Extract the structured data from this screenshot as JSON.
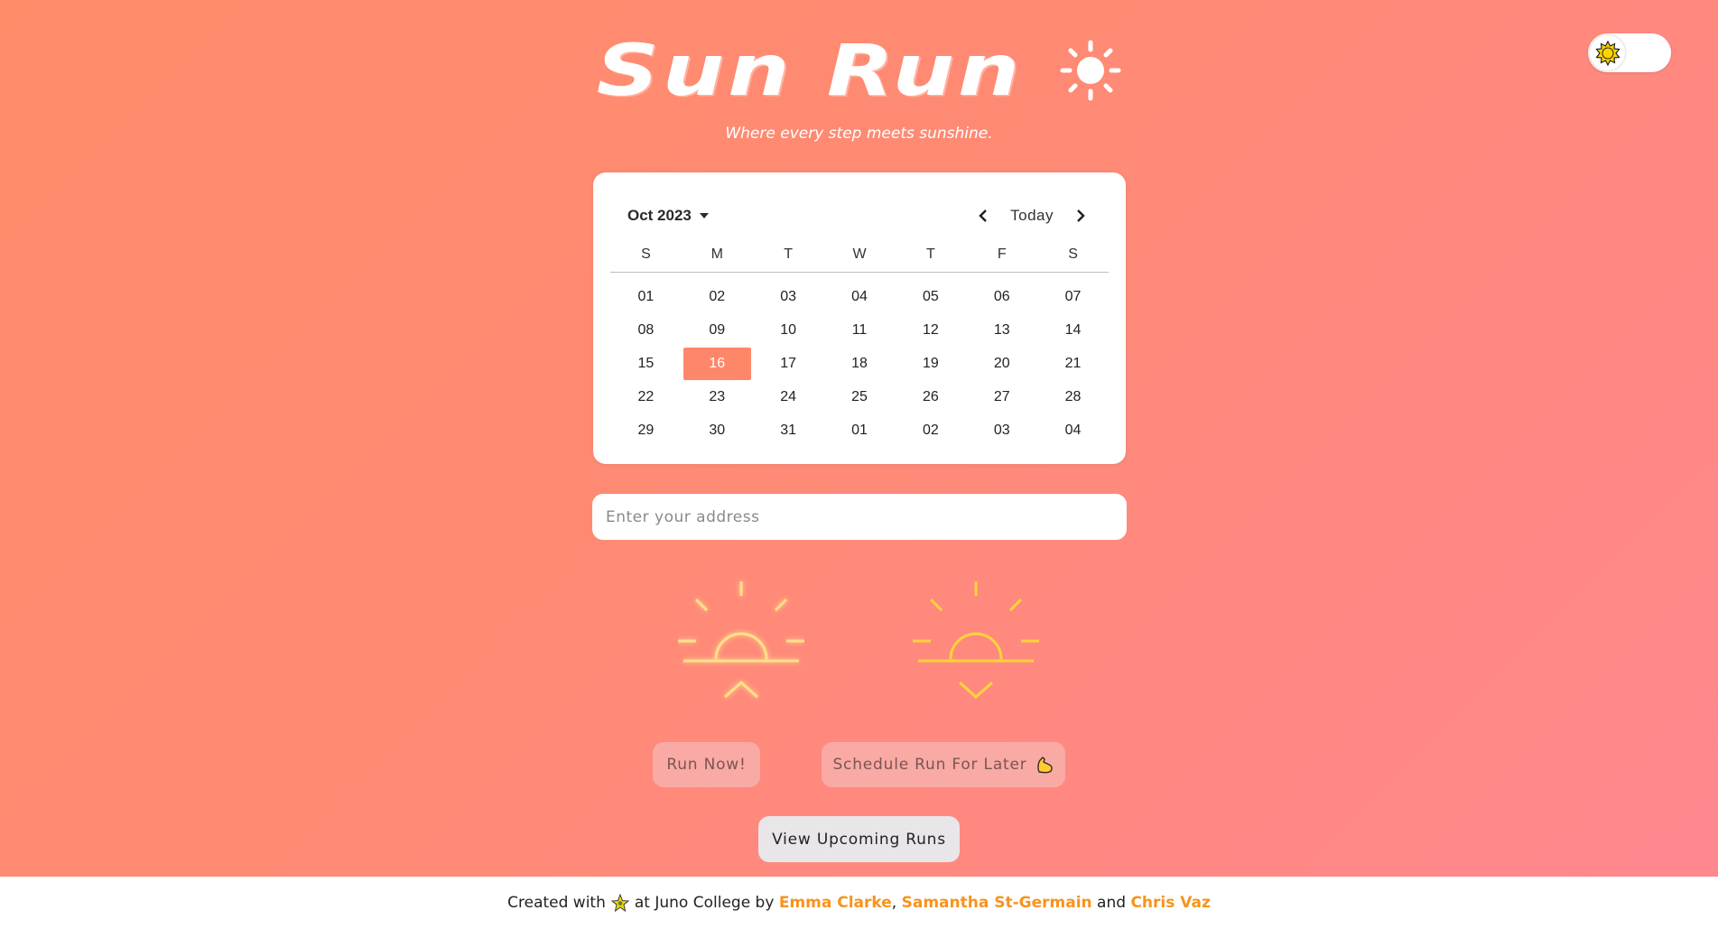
{
  "header": {
    "title": "Sun Run",
    "tagline": "Where every step meets sunshine."
  },
  "theme_toggle": {
    "icon": "sun-icon",
    "state": "light"
  },
  "calendar": {
    "month_label": "Oct 2023",
    "today_label": "Today",
    "weekdays": [
      "S",
      "M",
      "T",
      "W",
      "T",
      "F",
      "S"
    ],
    "days": [
      "01",
      "02",
      "03",
      "04",
      "05",
      "06",
      "07",
      "08",
      "09",
      "10",
      "11",
      "12",
      "13",
      "14",
      "15",
      "16",
      "17",
      "18",
      "19",
      "20",
      "21",
      "22",
      "23",
      "24",
      "25",
      "26",
      "27",
      "28",
      "29",
      "30",
      "31",
      "01",
      "02",
      "03",
      "04"
    ],
    "selected_day": "16"
  },
  "address": {
    "placeholder": "Enter your address",
    "value": ""
  },
  "options": {
    "sunrise_icon": "sunrise-icon",
    "sunset_icon": "sunset-icon"
  },
  "buttons": {
    "run_now": "Run Now!",
    "schedule": "Schedule Run For Later",
    "schedule_emoji": "flexed-arm-icon",
    "upcoming": "View Upcoming Runs"
  },
  "footer": {
    "created_with": "Created with",
    "heart_icon": "sparkle-star-icon",
    "at": "at Juno College by",
    "author1": "Emma Clarke",
    "comma": ",",
    "author2": "Samantha St-Germain",
    "and": "and",
    "author3": "Chris Vaz"
  },
  "colors": {
    "accent": "#ff8769",
    "sun_yellow": "#ffd54a",
    "author_link": "#f7931e"
  }
}
